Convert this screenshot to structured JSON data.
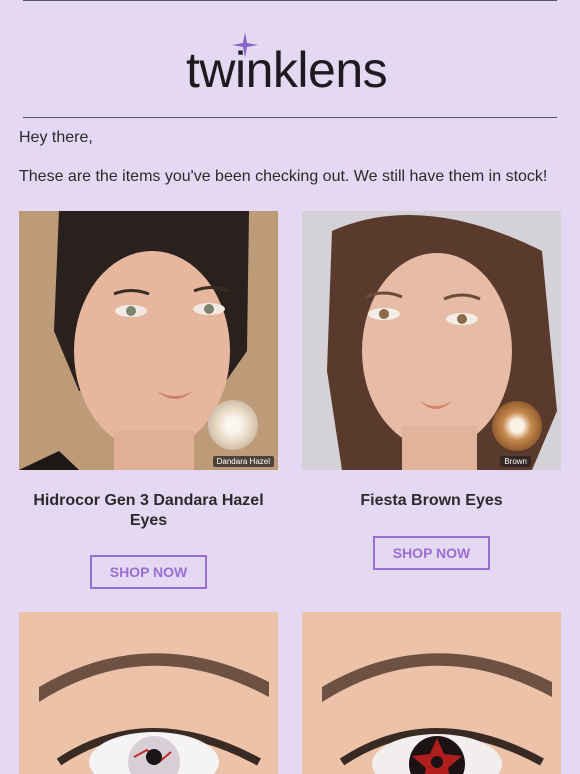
{
  "brand": {
    "name": "twinklens",
    "accent_color": "#9a6fd3",
    "background": "#e4d8f2"
  },
  "email": {
    "greeting": "Hey there,",
    "intro": "These are the items you've been checking out. We still have them in stock!"
  },
  "products": [
    {
      "name": "Hidrocor Gen 3 Dandara Hazel Eyes",
      "swatch_label": "Dandara Hazel",
      "button": "SHOP NOW"
    },
    {
      "name": "Fiesta Brown Eyes",
      "swatch_label": "Brown",
      "button": "SHOP NOW"
    },
    {
      "name": "",
      "swatch_label": "",
      "button": ""
    },
    {
      "name": "",
      "swatch_label": "",
      "button": ""
    }
  ]
}
